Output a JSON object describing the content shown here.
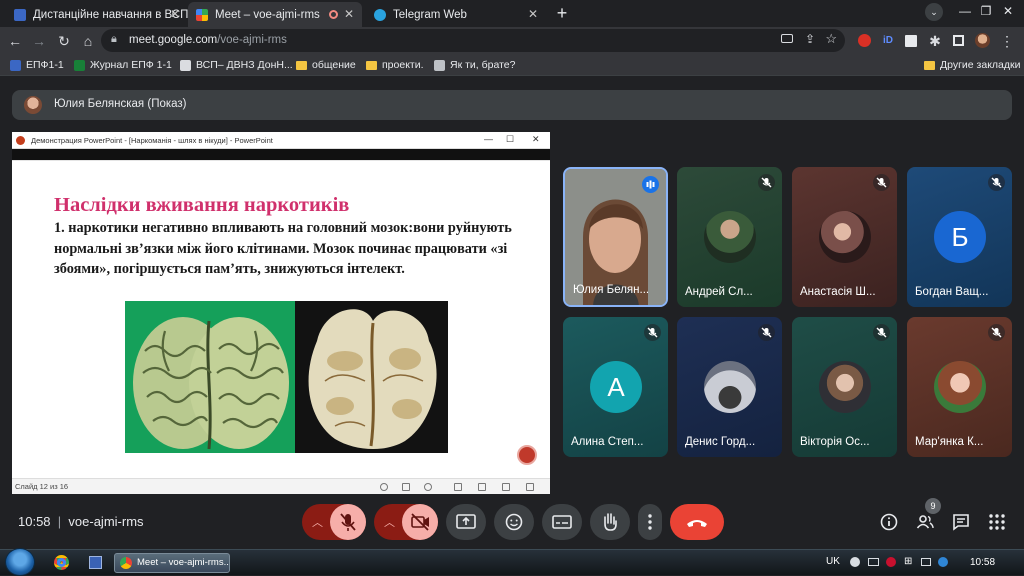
{
  "browser": {
    "tabs": [
      {
        "title": "Дистанційне навчання в ВСП",
        "active": false
      },
      {
        "title": "Meet – voe-ajmi-rms",
        "active": true
      },
      {
        "title": "Telegram Web",
        "active": false
      }
    ],
    "url_host": "meet.google.com",
    "url_path": "/voe-ajmi-rms",
    "bookmarks": [
      {
        "label": "ЕПФ1-1",
        "type": "site"
      },
      {
        "label": "Журнал ЕПФ 1-1",
        "type": "site"
      },
      {
        "label": "ВСП– ДВНЗ ДонН...",
        "type": "site"
      },
      {
        "label": "общение",
        "type": "folder"
      },
      {
        "label": "проекти.",
        "type": "folder"
      },
      {
        "label": "Як ти, брате?",
        "type": "site"
      }
    ],
    "other_bookmarks": "Другие закладки"
  },
  "meet": {
    "presenter_label": "Юлия Белянская (Показ)",
    "time": "10:58",
    "meeting_code": "voe-ajmi-rms",
    "people_count": "9",
    "colors": {
      "accent": "#8ab4f8",
      "hangup": "#ea4335",
      "muted_bg": "#8b1c14",
      "muted_fg": "#f6aea9"
    }
  },
  "presentation": {
    "window_title": "Демонстрация PowerPoint - [Наркоманія - шлях в нікуди] - PowerPoint",
    "slide_title": "Наслідки вживання наркотиків",
    "slide_body": "1. наркотики негативно впливають на головний мозок:вони руйнують нормальні зв’язки між його клітинами. Мозок починає працювати «зі збоями», погіршується пам’ять, знижуються інтелект.",
    "status": "Слайд 12 из 16"
  },
  "participants": [
    {
      "name": "Юлия Белян...",
      "type": "video",
      "mic": "speaking"
    },
    {
      "name": "Андрей Сл...",
      "type": "photo",
      "mic": "muted"
    },
    {
      "name": "Анастасія Ш...",
      "type": "photo",
      "mic": "muted"
    },
    {
      "name": "Богдан Ващ...",
      "type": "letter",
      "letter": "Б",
      "mic": "muted"
    },
    {
      "name": "Алина Степ...",
      "type": "letter",
      "letter": "А",
      "mic": "muted"
    },
    {
      "name": "Денис Горд...",
      "type": "photo",
      "mic": "muted"
    },
    {
      "name": "Вікторія Ос...",
      "type": "photo",
      "mic": "muted"
    },
    {
      "name": "Мар'янка К...",
      "type": "photo",
      "mic": "muted"
    }
  ],
  "taskbar": {
    "active_item": "Meet – voe-ajmi-rms...",
    "lang": "UK",
    "time": "10:58"
  }
}
